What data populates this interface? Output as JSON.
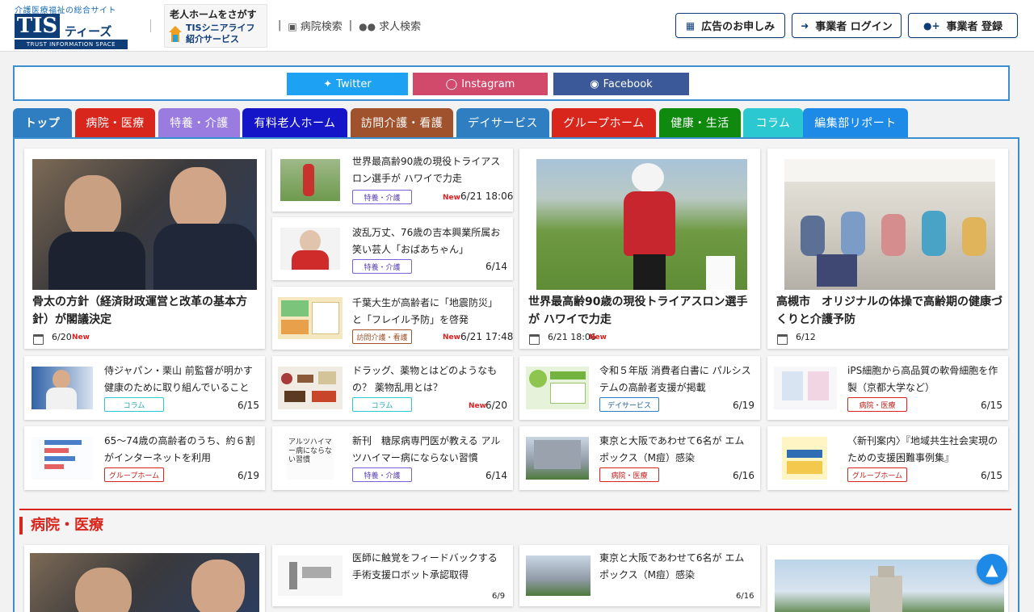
{
  "header": {
    "logo_tag": "介護医療福祉の総合サイト",
    "logo_main": "TIS",
    "logo_kana": "ティーズ",
    "logo_sub": "TRUST INFORMATION SPACE",
    "banner_line1": "老人ホームをさがす",
    "banner_line2a": "TISシニアライフ",
    "banner_line2b": "紹介サービス",
    "nav_hospital": "病院検索",
    "nav_sep1": "|",
    "nav_sep2": "|",
    "nav_jobs": "求人検索",
    "btn_ad": "広告のお申しみ",
    "btn_login": "事業者 ログイン",
    "btn_register": "事業者 登録"
  },
  "social": {
    "twitter": "Twitter",
    "instagram": "Instagram",
    "facebook": "Facebook"
  },
  "tabs": [
    {
      "label": "トップ",
      "color": "#2f7ec1"
    },
    {
      "label": "病院・医療",
      "color": "#d9261c"
    },
    {
      "label": "特養・介護",
      "color": "#9a7be0"
    },
    {
      "label": "有料老人ホーム",
      "color": "#1414c8"
    },
    {
      "label": "訪問介護・看護",
      "color": "#a0522d"
    },
    {
      "label": "デイサービス",
      "color": "#2f7ec1"
    },
    {
      "label": "グループホーム",
      "color": "#d9261c"
    },
    {
      "label": "健康・生活",
      "color": "#0f8a0f"
    },
    {
      "label": "コラム",
      "color": "#2bc8d2"
    },
    {
      "label": "編集部リポート",
      "color": "#1d8ae8"
    }
  ],
  "featured": [
    {
      "title": "骨太の方針（経済財政運営と改革の基本方針）が閣議決定",
      "date": "6/20",
      "new": "New"
    },
    {
      "title": "世界最高齢90歳の現役トライアスロン選手が ハワイで力走",
      "date": "6/21 18:06",
      "new": "New"
    },
    {
      "title": "高槻市　オリジナルの体操で高齢期の健康づくりと介護予防",
      "date": "6/12",
      "new": ""
    }
  ],
  "sidecol": [
    {
      "title": "世界最高齢90歳の現役トライアスロン選手が ハワイで力走",
      "badge": "特養・介護",
      "new": "New",
      "date": "6/21 18:06"
    },
    {
      "title": "波乱万丈、76歳の吉本興業所属お笑い芸人「おばあちゃん」",
      "badge": "特養・介護",
      "new": "",
      "date": "6/14"
    },
    {
      "title": "千葉大生が高齢者に「地震防災」と「フレイル予防」を啓発",
      "badge": "訪問介護・看護",
      "new": "New",
      "date": "6/21 17:48"
    }
  ],
  "grid": [
    {
      "title": "侍ジャパン・栗山 前監督が明かす健康のために取り組んでいること",
      "badge": "コラム",
      "new": "",
      "date": "6/15"
    },
    {
      "title": "ドラッグ、薬物とはどのようなもの？ 薬物乱用とは？",
      "badge": "コラム",
      "new": "New",
      "date": "6/20"
    },
    {
      "title": "令和５年版 消費者白書に パルシステムの高齢者支援が掲載",
      "badge": "デイサービス",
      "new": "",
      "date": "6/19"
    },
    {
      "title": "iPS細胞から高品質の軟骨細胞を作製（京都大学など）",
      "badge": "病院・医療",
      "new": "",
      "date": "6/15"
    },
    {
      "title": "65～74歳の高齢者のうち、約６割がインターネットを利用",
      "badge": "グループホーム",
      "new": "",
      "date": "6/19"
    },
    {
      "title": "新刊　糖尿病専門医が教える アルツハイマー病にならない習慣",
      "badge": "特養・介護",
      "new": "",
      "date": "6/14"
    },
    {
      "title": "東京と大阪であわせて6名が エムポックス（M痘）感染",
      "badge": "病院・医療",
      "new": "",
      "date": "6/16"
    },
    {
      "title": "〈新刊案内〉『地域共生社会実現のための支援困難事例集』",
      "badge": "グループホーム",
      "new": "",
      "date": "6/15"
    }
  ],
  "section": {
    "title": "病院・医療",
    "items": [
      {
        "title": "医師に触覚をフィードバックする手術支援ロボット承認取得",
        "date": "6/9"
      },
      {
        "title": "東京と大阪であわせて6名が エムポックス（M痘）感染",
        "date": "6/16"
      }
    ]
  },
  "thumb_texts": {
    "alz_book": "アルツハイマー病にならない習慣"
  },
  "colors": {
    "brand": "#0e3d78",
    "accent": "#3a8fd1",
    "new": "#e02020",
    "twitter": "#1da1f2",
    "instagram": "#d14a6c",
    "facebook": "#3b5998"
  }
}
